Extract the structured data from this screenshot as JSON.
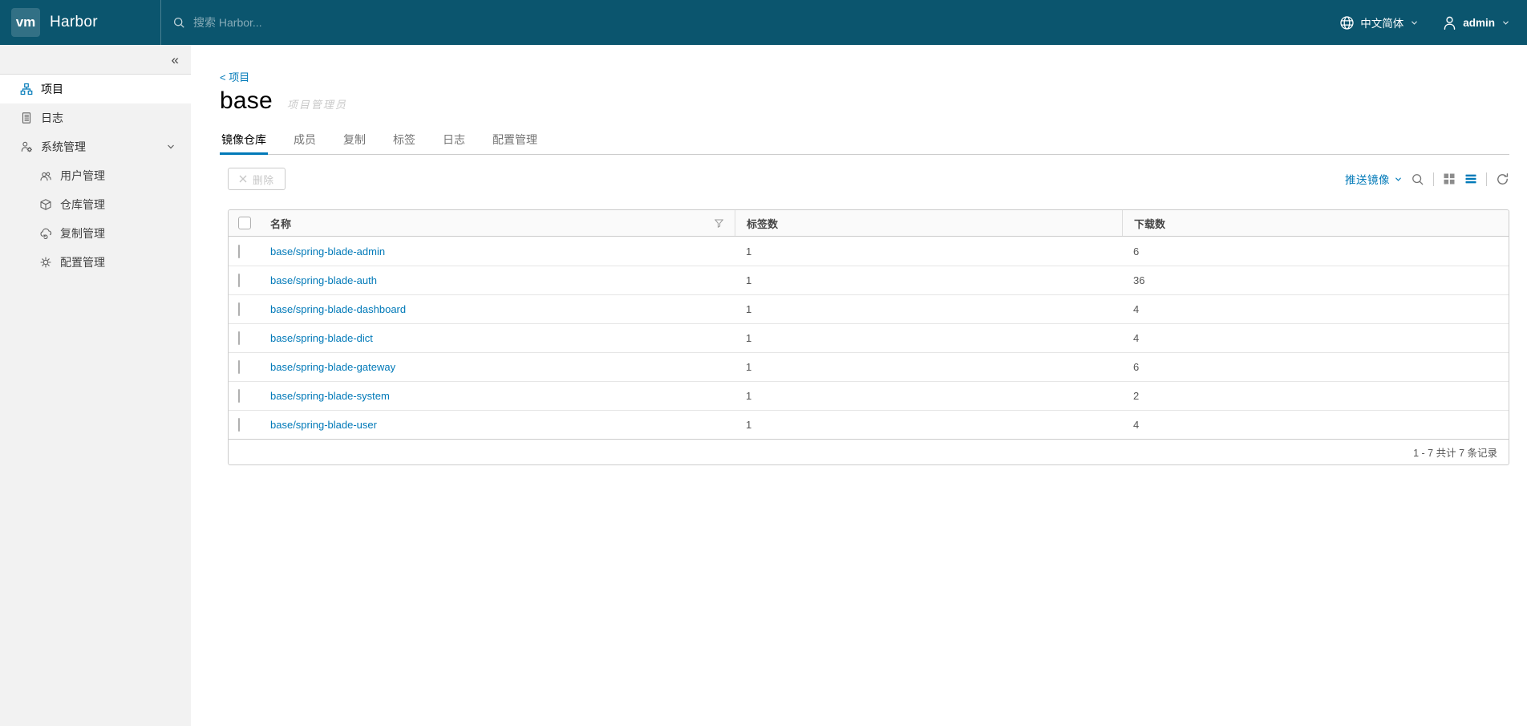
{
  "colors": {
    "header_bg": "#0b556e",
    "accent": "#0079b8",
    "link": "#0079b8",
    "sidebar_bg": "#f2f2f2",
    "tab_underline": "#0079b8"
  },
  "icons": {
    "logo": "vm-monogram",
    "search": "magnifier",
    "globe": "globe",
    "user": "person-silhouette",
    "caret": "chevron-down",
    "collapse": "double-chevron-left",
    "projects": "org-chart",
    "logs": "document-list",
    "admin": "user-gear",
    "users": "people",
    "registries": "cube",
    "replications": "cloud-sync",
    "configs": "gear",
    "delete": "x-cross",
    "filter": "funnel",
    "card_view": "grid-squares",
    "list_view": "list-lines",
    "refresh": "circular-arrow"
  },
  "navbar": {
    "logo_text": "vm",
    "brand": "Harbor",
    "search_placeholder": "搜索 Harbor...",
    "language": "中文简体",
    "user": "admin"
  },
  "sidebar": {
    "collapse_glyph": "«",
    "items": [
      {
        "label": "项目",
        "active": true
      },
      {
        "label": "日志",
        "active": false
      },
      {
        "label": "系统管理",
        "active": false,
        "expanded": true
      }
    ],
    "admin_children": [
      {
        "label": "用户管理"
      },
      {
        "label": "仓库管理"
      },
      {
        "label": "复制管理"
      },
      {
        "label": "配置管理"
      }
    ]
  },
  "main": {
    "breadcrumb": "< 项目",
    "title": "base",
    "role_badge": "项目管理员",
    "tabs": [
      {
        "label": "镜像仓库",
        "active": true
      },
      {
        "label": "成员",
        "active": false
      },
      {
        "label": "复制",
        "active": false
      },
      {
        "label": "标签",
        "active": false
      },
      {
        "label": "日志",
        "active": false
      },
      {
        "label": "配置管理",
        "active": false
      }
    ],
    "toolbar": {
      "delete_label": "删除",
      "push_image_label": "推送镜像"
    },
    "table": {
      "columns": {
        "name": "名称",
        "tags": "标签数",
        "pulls": "下载数"
      },
      "rows": [
        {
          "name": "base/spring-blade-admin",
          "tags": "1",
          "pulls": "6"
        },
        {
          "name": "base/spring-blade-auth",
          "tags": "1",
          "pulls": "36"
        },
        {
          "name": "base/spring-blade-dashboard",
          "tags": "1",
          "pulls": "4"
        },
        {
          "name": "base/spring-blade-dict",
          "tags": "1",
          "pulls": "4"
        },
        {
          "name": "base/spring-blade-gateway",
          "tags": "1",
          "pulls": "6"
        },
        {
          "name": "base/spring-blade-system",
          "tags": "1",
          "pulls": "2"
        },
        {
          "name": "base/spring-blade-user",
          "tags": "1",
          "pulls": "4"
        }
      ],
      "footer": "1 - 7 共计 7 条记录"
    }
  }
}
